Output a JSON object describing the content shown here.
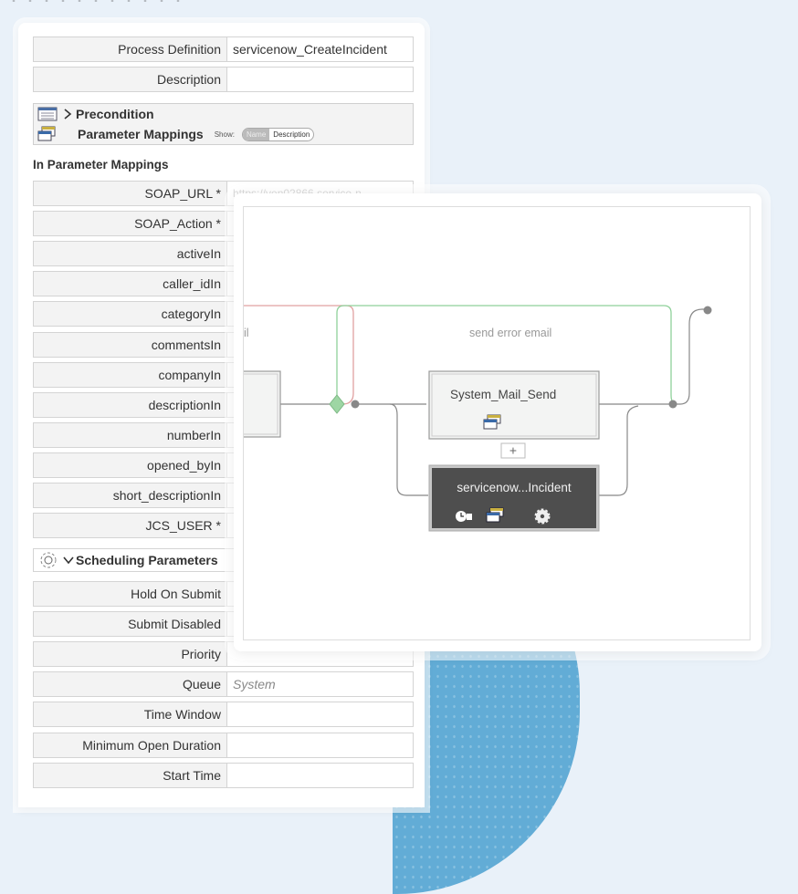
{
  "form": {
    "process_definition": {
      "label": "Process Definition",
      "value": "servicenow_CreateIncident"
    },
    "description": {
      "label": "Description",
      "value": ""
    },
    "precondition": {
      "label": "Precondition"
    },
    "parameter_mappings": {
      "label": "Parameter Mappings",
      "show_label": "Show:",
      "toggle_name": "Name",
      "toggle_description": "Description"
    },
    "in_parameter_mappings_title": "In Parameter Mappings",
    "params": [
      {
        "label": "SOAP_URL *",
        "value": "https://ven02866.service-n"
      },
      {
        "label": "SOAP_Action *",
        "value": ""
      },
      {
        "label": "activeIn",
        "value": ""
      },
      {
        "label": "caller_idIn",
        "value": ""
      },
      {
        "label": "categoryIn",
        "value": ""
      },
      {
        "label": "commentsIn",
        "value": ""
      },
      {
        "label": "companyIn",
        "value": ""
      },
      {
        "label": "descriptionIn",
        "value": ""
      },
      {
        "label": "numberIn",
        "value": ""
      },
      {
        "label": "opened_byIn",
        "value": ""
      },
      {
        "label": "short_descriptionIn",
        "value": ""
      },
      {
        "label": "JCS_USER *",
        "value": ""
      }
    ],
    "scheduling": {
      "label": "Scheduling Parameters"
    },
    "sched_params": [
      {
        "label": "Hold On Submit",
        "value": ""
      },
      {
        "label": "Submit Disabled",
        "value": ""
      },
      {
        "label": "Priority",
        "value": ""
      },
      {
        "label": "Queue",
        "value": "System"
      },
      {
        "label": "Time Window",
        "value": ""
      },
      {
        "label": "Minimum Open Duration",
        "value": ""
      },
      {
        "label": "Start Time",
        "value": ""
      }
    ]
  },
  "diagram": {
    "left_label_fragment": "il",
    "error_label": "send error email",
    "mail_step": "System_Mail_Send",
    "incident_step": "servicenow...Incident",
    "add_button": "+"
  },
  "colors": {
    "error_line": "#e0a0a0",
    "success_line": "#8fd19a",
    "flow_line": "#888888",
    "dark_step": "#555555",
    "blob": "#62acd6"
  }
}
